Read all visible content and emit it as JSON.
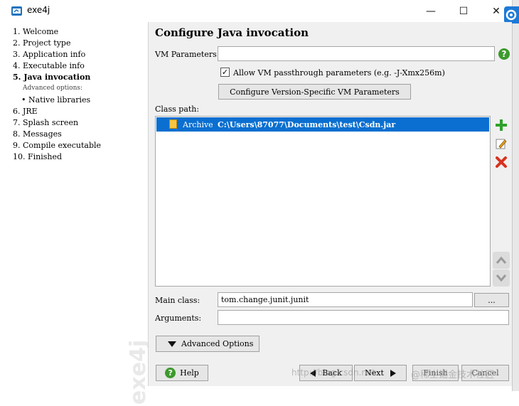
{
  "window": {
    "title": "exe4j",
    "min_glyph": "—",
    "max_glyph": "☐",
    "close_glyph": "✕"
  },
  "steps": [
    {
      "label": "1.  Welcome"
    },
    {
      "label": "2.  Project type"
    },
    {
      "label": "3.  Application info"
    },
    {
      "label": "4.  Executable info"
    },
    {
      "label": "5.  Java invocation"
    },
    {
      "label": "Advanced options:"
    },
    {
      "label": "• Native libraries"
    },
    {
      "label": "6.  JRE"
    },
    {
      "label": "7.  Splash screen"
    },
    {
      "label": "8.  Messages"
    },
    {
      "label": "9.  Compile executable"
    },
    {
      "label": "10.  Finished"
    }
  ],
  "sidebar_watermark": "exe4j",
  "page": {
    "title": "Configure Java invocation",
    "vm_parameters_label": "VM Parameters:",
    "vm_parameters_value": "",
    "help_glyph": "?",
    "allow_passthrough_label": "Allow VM passthrough parameters (e.g. -J-Xmx256m)",
    "allow_passthrough_checked": true,
    "check_glyph": "✓",
    "version_specific_button": "Configure Version-Specific VM Parameters",
    "class_path_label": "Class path:",
    "class_path_entries": [
      {
        "type": "Archive",
        "path": "C:\\Users\\87077\\Documents\\test\\Csdn.jar"
      }
    ],
    "main_class_label": "Main class:",
    "main_class_value": "tom.change.junit.junit",
    "browse_button": "...",
    "arguments_label": "Arguments:",
    "arguments_value": "",
    "advanced_options_button": "Advanced Options"
  },
  "footer": {
    "help_button": "Help",
    "back_button": "Back",
    "next_button": "Next",
    "finish_button": "Finish",
    "cancel_button": "Cancel",
    "overlay_watermark": "@稀土掘金技术社区",
    "overlay_url": "http://blog.csdn.net"
  }
}
